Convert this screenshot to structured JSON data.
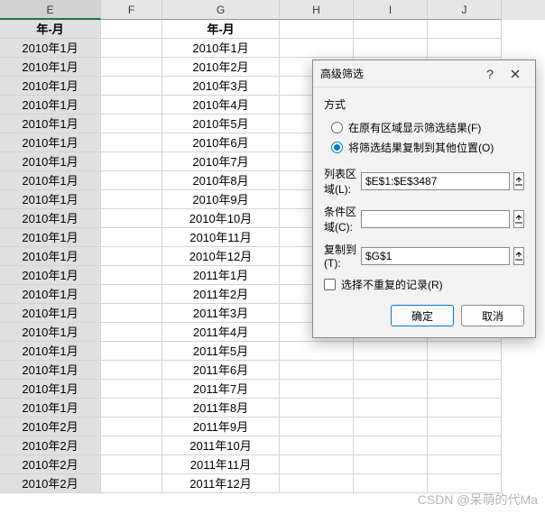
{
  "columns": [
    "E",
    "F",
    "G",
    "H",
    "I",
    "J"
  ],
  "headers": {
    "E": "年-月",
    "G": "年-月"
  },
  "rows": [
    {
      "E": "2010年1月",
      "G": "2010年1月"
    },
    {
      "E": "2010年1月",
      "G": "2010年2月"
    },
    {
      "E": "2010年1月",
      "G": "2010年3月"
    },
    {
      "E": "2010年1月",
      "G": "2010年4月"
    },
    {
      "E": "2010年1月",
      "G": "2010年5月"
    },
    {
      "E": "2010年1月",
      "G": "2010年6月"
    },
    {
      "E": "2010年1月",
      "G": "2010年7月"
    },
    {
      "E": "2010年1月",
      "G": "2010年8月"
    },
    {
      "E": "2010年1月",
      "G": "2010年9月"
    },
    {
      "E": "2010年1月",
      "G": "2010年10月"
    },
    {
      "E": "2010年1月",
      "G": "2010年11月"
    },
    {
      "E": "2010年1月",
      "G": "2010年12月"
    },
    {
      "E": "2010年1月",
      "G": "2011年1月"
    },
    {
      "E": "2010年1月",
      "G": "2011年2月"
    },
    {
      "E": "2010年1月",
      "G": "2011年3月"
    },
    {
      "E": "2010年1月",
      "G": "2011年4月"
    },
    {
      "E": "2010年1月",
      "G": "2011年5月"
    },
    {
      "E": "2010年1月",
      "G": "2011年6月"
    },
    {
      "E": "2010年1月",
      "G": "2011年7月"
    },
    {
      "E": "2010年1月",
      "G": "2011年8月"
    },
    {
      "E": "2010年2月",
      "G": "2011年9月"
    },
    {
      "E": "2010年2月",
      "G": "2011年10月"
    },
    {
      "E": "2010年2月",
      "G": "2011年11月"
    },
    {
      "E": "2010年2月",
      "G": "2011年12月"
    }
  ],
  "dialog": {
    "title": "高级筛选",
    "section_label": "方式",
    "radio1": "在原有区域显示筛选结果(F)",
    "radio2": "将筛选结果复制到其他位置(O)",
    "radio_selected": 2,
    "field_list_label": "列表区域(L):",
    "field_list_value": "$E$1:$E$3487",
    "field_criteria_label": "条件区域(C):",
    "field_criteria_value": "",
    "field_copyto_label": "复制到(T):",
    "field_copyto_value": "$G$1",
    "checkbox_label": "选择不重复的记录(R)",
    "checkbox_checked": false,
    "ok_label": "确定",
    "cancel_label": "取消"
  },
  "watermark": "CSDN @呆萌的代Ma"
}
